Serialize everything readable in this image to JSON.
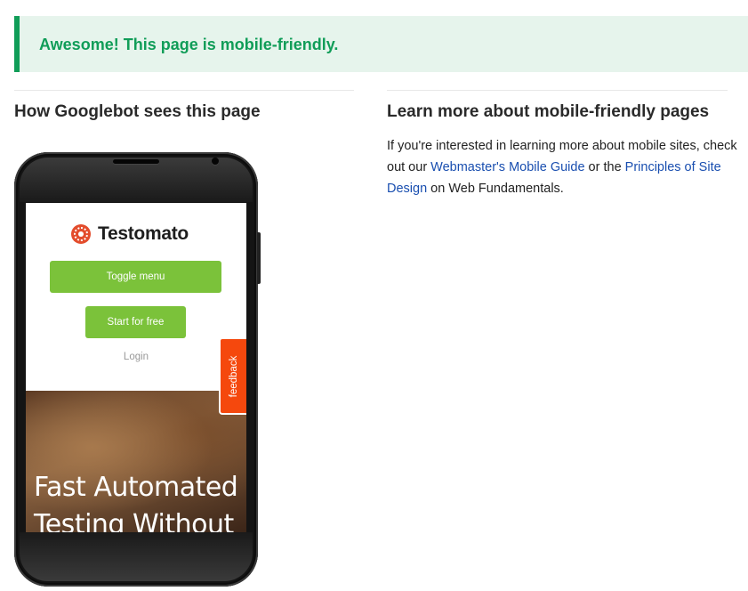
{
  "banner": {
    "message": "Awesome! This page is mobile-friendly."
  },
  "left": {
    "heading": "How Googlebot sees this page"
  },
  "right": {
    "heading": "Learn more about mobile-friendly pages",
    "text_before": "If you're interested in learning more about mobile sites, check out our ",
    "link1": "Webmaster's Mobile Guide",
    "text_middle": " or the ",
    "link2": "Principles of Site Design",
    "text_after": " on Web Fundamentals."
  },
  "phone_screen": {
    "logo_text": "Testomato",
    "toggle_menu_label": "Toggle menu",
    "start_label": "Start for free",
    "login_label": "Login",
    "hero_text": "Fast Automated Testing Without",
    "feedback_label": "feedback"
  },
  "colors": {
    "success_green": "#109d58",
    "banner_bg": "#e6f4ec",
    "link_blue": "#1a4fb0",
    "button_green": "#7bc23a",
    "feedback_orange": "#f5480d"
  }
}
